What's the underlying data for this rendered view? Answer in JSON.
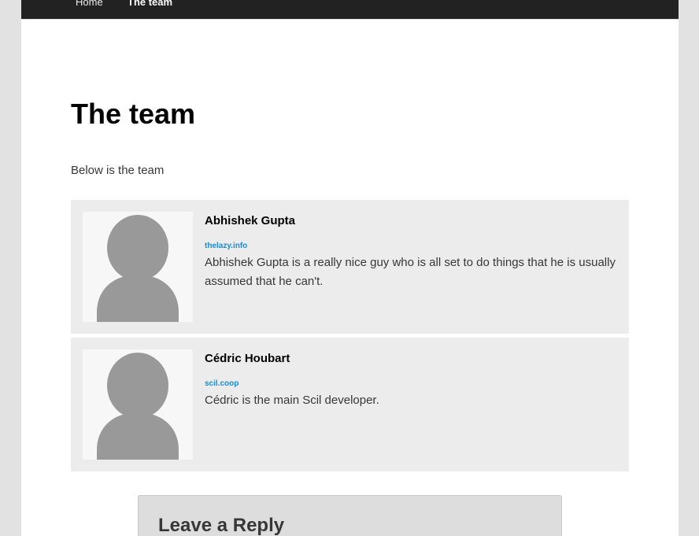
{
  "nav": {
    "items": [
      {
        "label": "Home"
      },
      {
        "label": "The team"
      }
    ]
  },
  "page": {
    "title": "The team",
    "intro": "Below is the team"
  },
  "members": [
    {
      "name": "Abhishek Gupta",
      "link": "thelazy.info",
      "bio": "Abhishek Gupta is a really nice guy who is all set to do things that he is usually assumed that he can't.",
      "avatar_icon": "default-user-avatar-icon"
    },
    {
      "name": "Cédric Houbart",
      "link": "scil.coop",
      "bio": "Cédric is the main Scil developer.",
      "avatar_icon": "default-user-avatar-icon"
    }
  ],
  "comments": {
    "reply_title": "Leave a Reply"
  },
  "colors": {
    "navbar": "#222222",
    "card_background": "#ececec",
    "link": "#1b8be0",
    "avatar_silhouette": "#999999"
  }
}
